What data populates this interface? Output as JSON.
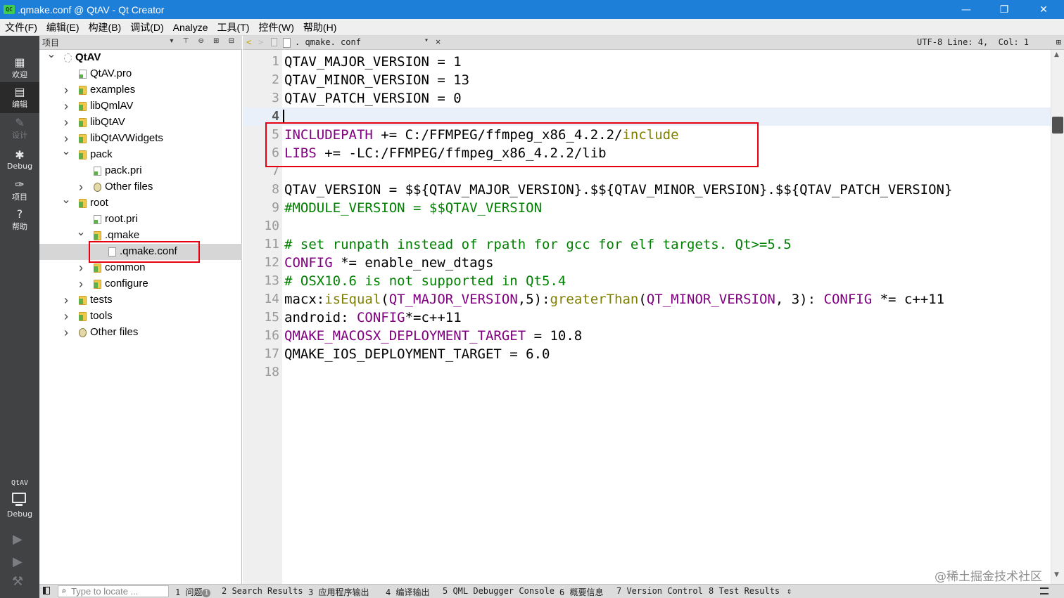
{
  "window": {
    "title": ".qmake.conf @ QtAV - Qt Creator",
    "app_icon": "QC",
    "minimize": "—",
    "maximize": "❐",
    "close": "✕"
  },
  "menu": [
    "文件(F)",
    "编辑(E)",
    "构建(B)",
    "调试(D)",
    "Analyze",
    "工具(T)",
    "控件(W)",
    "帮助(H)"
  ],
  "modes": [
    {
      "label": "欢迎",
      "icon": "grid-icon",
      "glyph": "▦"
    },
    {
      "label": "编辑",
      "icon": "edit-icon",
      "glyph": "▤"
    },
    {
      "label": "设计",
      "icon": "design-pen-icon",
      "glyph": "✎"
    },
    {
      "label": "Debug",
      "icon": "bug-icon",
      "glyph": "✱"
    },
    {
      "label": "项目",
      "icon": "wrench-icon",
      "glyph": "✑"
    },
    {
      "label": "帮助",
      "icon": "help-icon",
      "glyph": "?"
    }
  ],
  "kit": {
    "name": "QtAV",
    "mode": "Debug",
    "icon": "monitor-icon"
  },
  "actions": {
    "run": "▶",
    "debug_run": "▶",
    "build": "⚒"
  },
  "project_panel": {
    "title": "项目",
    "tools": "▾ ⊤ ⊖ ⊞ ⊟",
    "tree": [
      {
        "label": "QtAV",
        "depth": 0,
        "expand": "v",
        "icon": "project",
        "bold": true
      },
      {
        "label": "QtAV.pro",
        "depth": 1,
        "expand": "",
        "icon": "pro"
      },
      {
        "label": "examples",
        "depth": 1,
        "expand": ">",
        "icon": "folder"
      },
      {
        "label": "libQmlAV",
        "depth": 1,
        "expand": ">",
        "icon": "folder"
      },
      {
        "label": "libQtAV",
        "depth": 1,
        "expand": ">",
        "icon": "folder"
      },
      {
        "label": "libQtAVWidgets",
        "depth": 1,
        "expand": ">",
        "icon": "folder"
      },
      {
        "label": "pack",
        "depth": 1,
        "expand": "v",
        "icon": "folder"
      },
      {
        "label": "pack.pri",
        "depth": 2,
        "expand": "",
        "icon": "pri"
      },
      {
        "label": "Other files",
        "depth": 2,
        "expand": ">",
        "icon": "other"
      },
      {
        "label": "root",
        "depth": 1,
        "expand": "v",
        "icon": "folder"
      },
      {
        "label": "root.pri",
        "depth": 2,
        "expand": "",
        "icon": "pri"
      },
      {
        "label": ".qmake",
        "depth": 2,
        "expand": "v",
        "icon": "folder"
      },
      {
        "label": ".qmake.conf",
        "depth": 3,
        "expand": "",
        "icon": "file",
        "selected": true
      },
      {
        "label": "common",
        "depth": 2,
        "expand": ">",
        "icon": "folder"
      },
      {
        "label": "configure",
        "depth": 2,
        "expand": ">",
        "icon": "folder"
      },
      {
        "label": "tests",
        "depth": 1,
        "expand": ">",
        "icon": "folder"
      },
      {
        "label": "tools",
        "depth": 1,
        "expand": ">",
        "icon": "folder"
      },
      {
        "label": "Other files",
        "depth": 1,
        "expand": ">",
        "icon": "other"
      }
    ]
  },
  "editor_toolbar": {
    "back": "<",
    "forward": ">",
    "file_name": ". qmake. conf",
    "dropdown": "▾",
    "close": "✕",
    "encoding": "UTF-8",
    "position": "Line: 4,  Col: 1",
    "split": "⊞"
  },
  "editor": {
    "current_line": 4,
    "lines": [
      {
        "n": "1",
        "tokens": [
          {
            "t": "QTAV_MAJOR_VERSION = 1",
            "c": ""
          }
        ]
      },
      {
        "n": "2",
        "tokens": [
          {
            "t": "QTAV_MINOR_VERSION = 13",
            "c": ""
          }
        ]
      },
      {
        "n": "3",
        "tokens": [
          {
            "t": "QTAV_PATCH_VERSION = 0",
            "c": ""
          }
        ]
      },
      {
        "n": "4",
        "tokens": []
      },
      {
        "n": "5",
        "tokens": [
          {
            "t": "INCLUDEPATH",
            "c": "var"
          },
          {
            "t": " += C:/FFMPEG/ffmpeg_x86_4.2.2/",
            "c": ""
          },
          {
            "t": "include",
            "c": "kw"
          }
        ]
      },
      {
        "n": "6",
        "tokens": [
          {
            "t": "LIBS",
            "c": "var"
          },
          {
            "t": " += -LC:/FFMPEG/ffmpeg_x86_4.2.2/lib",
            "c": ""
          }
        ]
      },
      {
        "n": "7",
        "tokens": []
      },
      {
        "n": "8",
        "tokens": [
          {
            "t": "QTAV_VERSION = $${QTAV_MAJOR_VERSION}.$${QTAV_MINOR_VERSION}.$${QTAV_PATCH_VERSION}",
            "c": ""
          }
        ]
      },
      {
        "n": "9",
        "tokens": [
          {
            "t": "#MODULE_VERSION = $$QTAV_VERSION",
            "c": "cmt"
          }
        ]
      },
      {
        "n": "10",
        "tokens": []
      },
      {
        "n": "11",
        "tokens": [
          {
            "t": "# set runpath instead of rpath for gcc for elf targets. Qt>=5.5",
            "c": "cmt"
          }
        ]
      },
      {
        "n": "12",
        "tokens": [
          {
            "t": "CONFIG",
            "c": "var"
          },
          {
            "t": " *= enable_new_dtags",
            "c": ""
          }
        ]
      },
      {
        "n": "13",
        "tokens": [
          {
            "t": "# OSX10.6 is not supported in Qt5.4",
            "c": "cmt"
          }
        ]
      },
      {
        "n": "14",
        "tokens": [
          {
            "t": "macx:",
            "c": ""
          },
          {
            "t": "isEqual",
            "c": "kw"
          },
          {
            "t": "(",
            "c": ""
          },
          {
            "t": "QT_MAJOR_VERSION",
            "c": "var"
          },
          {
            "t": ",5):",
            "c": ""
          },
          {
            "t": "greaterThan",
            "c": "kw"
          },
          {
            "t": "(",
            "c": ""
          },
          {
            "t": "QT_MINOR_VERSION",
            "c": "var"
          },
          {
            "t": ", 3): ",
            "c": ""
          },
          {
            "t": "CONFIG",
            "c": "var"
          },
          {
            "t": " *= c++11",
            "c": ""
          }
        ]
      },
      {
        "n": "15",
        "tokens": [
          {
            "t": "android: ",
            "c": ""
          },
          {
            "t": "CONFIG",
            "c": "var"
          },
          {
            "t": "*=c++11",
            "c": ""
          }
        ]
      },
      {
        "n": "16",
        "tokens": [
          {
            "t": "QMAKE_MACOSX_DEPLOYMENT_TARGET",
            "c": "var"
          },
          {
            "t": " = 10.8",
            "c": ""
          }
        ]
      },
      {
        "n": "17",
        "tokens": [
          {
            "t": "QMAKE_IOS_DEPLOYMENT_TARGET = 6.0",
            "c": ""
          }
        ]
      },
      {
        "n": "18",
        "tokens": []
      }
    ]
  },
  "output_bar": {
    "locate_placeholder": "Type to locate ...",
    "search_glyph": "⌕",
    "issues_label": "1 问题",
    "issues_count": "1",
    "tabs": [
      "2 Search Results",
      "3 应用程序输出",
      "4 编译输出",
      "5 QML Debugger Console",
      "6 概要信息",
      "7 Version Control",
      "8 Test Results"
    ],
    "more": "⇕"
  },
  "watermark": "@稀土掘金技术社区",
  "colors": {
    "highlight_box": "#e60012",
    "titlebar": "#1e7fd8"
  }
}
